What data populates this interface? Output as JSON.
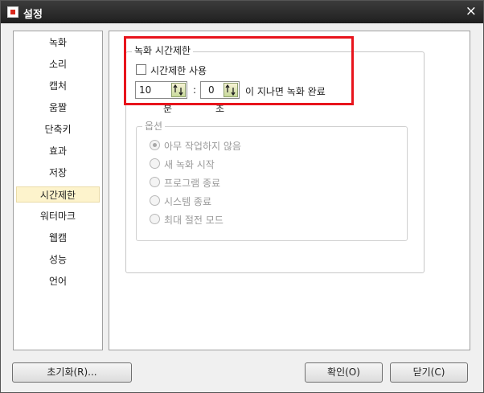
{
  "window": {
    "title": "설정",
    "close_glyph": "×"
  },
  "sidebar": {
    "items": [
      {
        "label": "녹화"
      },
      {
        "label": "소리"
      },
      {
        "label": "캡처"
      },
      {
        "label": "움짤"
      },
      {
        "label": "단축키"
      },
      {
        "label": "효과"
      },
      {
        "label": "저장"
      },
      {
        "label": "시간제한",
        "selected": true
      },
      {
        "label": "워터마크"
      },
      {
        "label": "웹캠"
      },
      {
        "label": "성능"
      },
      {
        "label": "언어"
      }
    ]
  },
  "time_limit": {
    "group_title": "녹화 시간제한",
    "use_checkbox_label": "시간제한 사용",
    "use_checked": false,
    "minutes_value": "10",
    "seconds_value": "0",
    "separator": ":",
    "after_text": "이 지나면 녹화  완료",
    "minutes_unit": "분",
    "seconds_unit": "초"
  },
  "options": {
    "group_title": "옵션",
    "items": [
      {
        "label": "아무 작업하지 않음",
        "checked": true
      },
      {
        "label": "새 녹화 시작",
        "checked": false
      },
      {
        "label": "프로그램 종료",
        "checked": false
      },
      {
        "label": "시스템 종료",
        "checked": false
      },
      {
        "label": "최대 절전 모드",
        "checked": false
      }
    ]
  },
  "buttons": {
    "reset": "초기화(R)...",
    "ok": "확인(O)",
    "close": "닫기(C)"
  },
  "colors": {
    "highlight_box": "#e8141c",
    "selected_item": "#fdf3cc",
    "titlebar": "#2a2a2a"
  }
}
